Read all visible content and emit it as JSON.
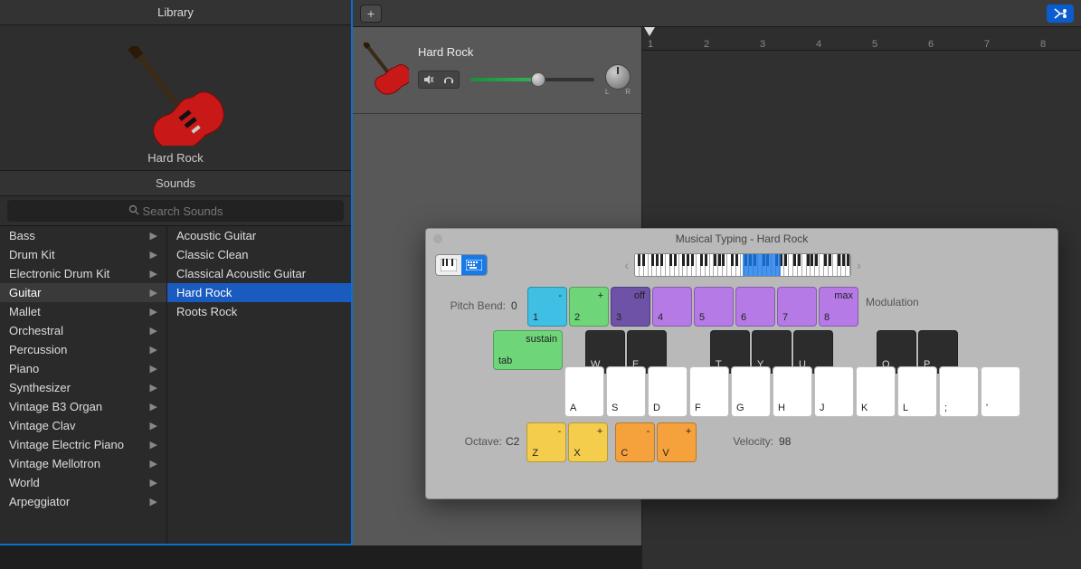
{
  "library": {
    "title": "Library",
    "instrument_name": "Hard Rock",
    "sounds_header": "Sounds",
    "search_placeholder": "Search Sounds",
    "categories": [
      {
        "label": "Bass"
      },
      {
        "label": "Drum Kit"
      },
      {
        "label": "Electronic Drum Kit"
      },
      {
        "label": "Guitar",
        "selected": true
      },
      {
        "label": "Mallet"
      },
      {
        "label": "Orchestral"
      },
      {
        "label": "Percussion"
      },
      {
        "label": "Piano"
      },
      {
        "label": "Synthesizer"
      },
      {
        "label": "Vintage B3 Organ"
      },
      {
        "label": "Vintage Clav"
      },
      {
        "label": "Vintage Electric Piano"
      },
      {
        "label": "Vintage Mellotron"
      },
      {
        "label": "World"
      },
      {
        "label": "Arpeggiator"
      }
    ],
    "presets": [
      {
        "label": "Acoustic Guitar"
      },
      {
        "label": "Classic Clean"
      },
      {
        "label": "Classical Acoustic Guitar"
      },
      {
        "label": "Hard Rock",
        "selected": true
      },
      {
        "label": "Roots Rock"
      }
    ]
  },
  "track": {
    "name": "Hard Rock",
    "pan_l": "L",
    "pan_r": "R"
  },
  "ruler": {
    "ticks": [
      "1",
      "2",
      "3",
      "4",
      "5",
      "6",
      "7",
      "8"
    ]
  },
  "musical_typing": {
    "window_title": "Musical Typing - Hard Rock",
    "pitch_bend_label": "Pitch Bend:",
    "pitch_bend_value": "0",
    "modulation_label": "Modulation",
    "mod_keys": [
      {
        "top": "-",
        "bot": "1",
        "cls": "cyan"
      },
      {
        "top": "+",
        "bot": "2",
        "cls": "green-l"
      },
      {
        "top": "off",
        "bot": "3",
        "cls": "purple-d"
      },
      {
        "top": "",
        "bot": "4",
        "cls": "purple"
      },
      {
        "top": "",
        "bot": "5",
        "cls": "purple"
      },
      {
        "top": "",
        "bot": "6",
        "cls": "purple"
      },
      {
        "top": "",
        "bot": "7",
        "cls": "purple"
      },
      {
        "top": "max",
        "bot": "8",
        "cls": "purple"
      }
    ],
    "sustain_top": "sustain",
    "sustain_bot": "tab",
    "black_keys": [
      "W",
      "E",
      "",
      "T",
      "Y",
      "U",
      "",
      "O",
      "P"
    ],
    "white_keys": [
      "A",
      "S",
      "D",
      "F",
      "G",
      "H",
      "J",
      "K",
      "L",
      ";",
      "'"
    ],
    "octave_label": "Octave:",
    "octave_value": "C2",
    "octave_keys": [
      {
        "top": "-",
        "bot": "Z",
        "cls": "yellow"
      },
      {
        "top": "+",
        "bot": "X",
        "cls": "yellow"
      }
    ],
    "transpose_keys": [
      {
        "top": "-",
        "bot": "C",
        "cls": "orange"
      },
      {
        "top": "+",
        "bot": "V",
        "cls": "orange"
      }
    ],
    "velocity_label": "Velocity:",
    "velocity_value": "98"
  }
}
